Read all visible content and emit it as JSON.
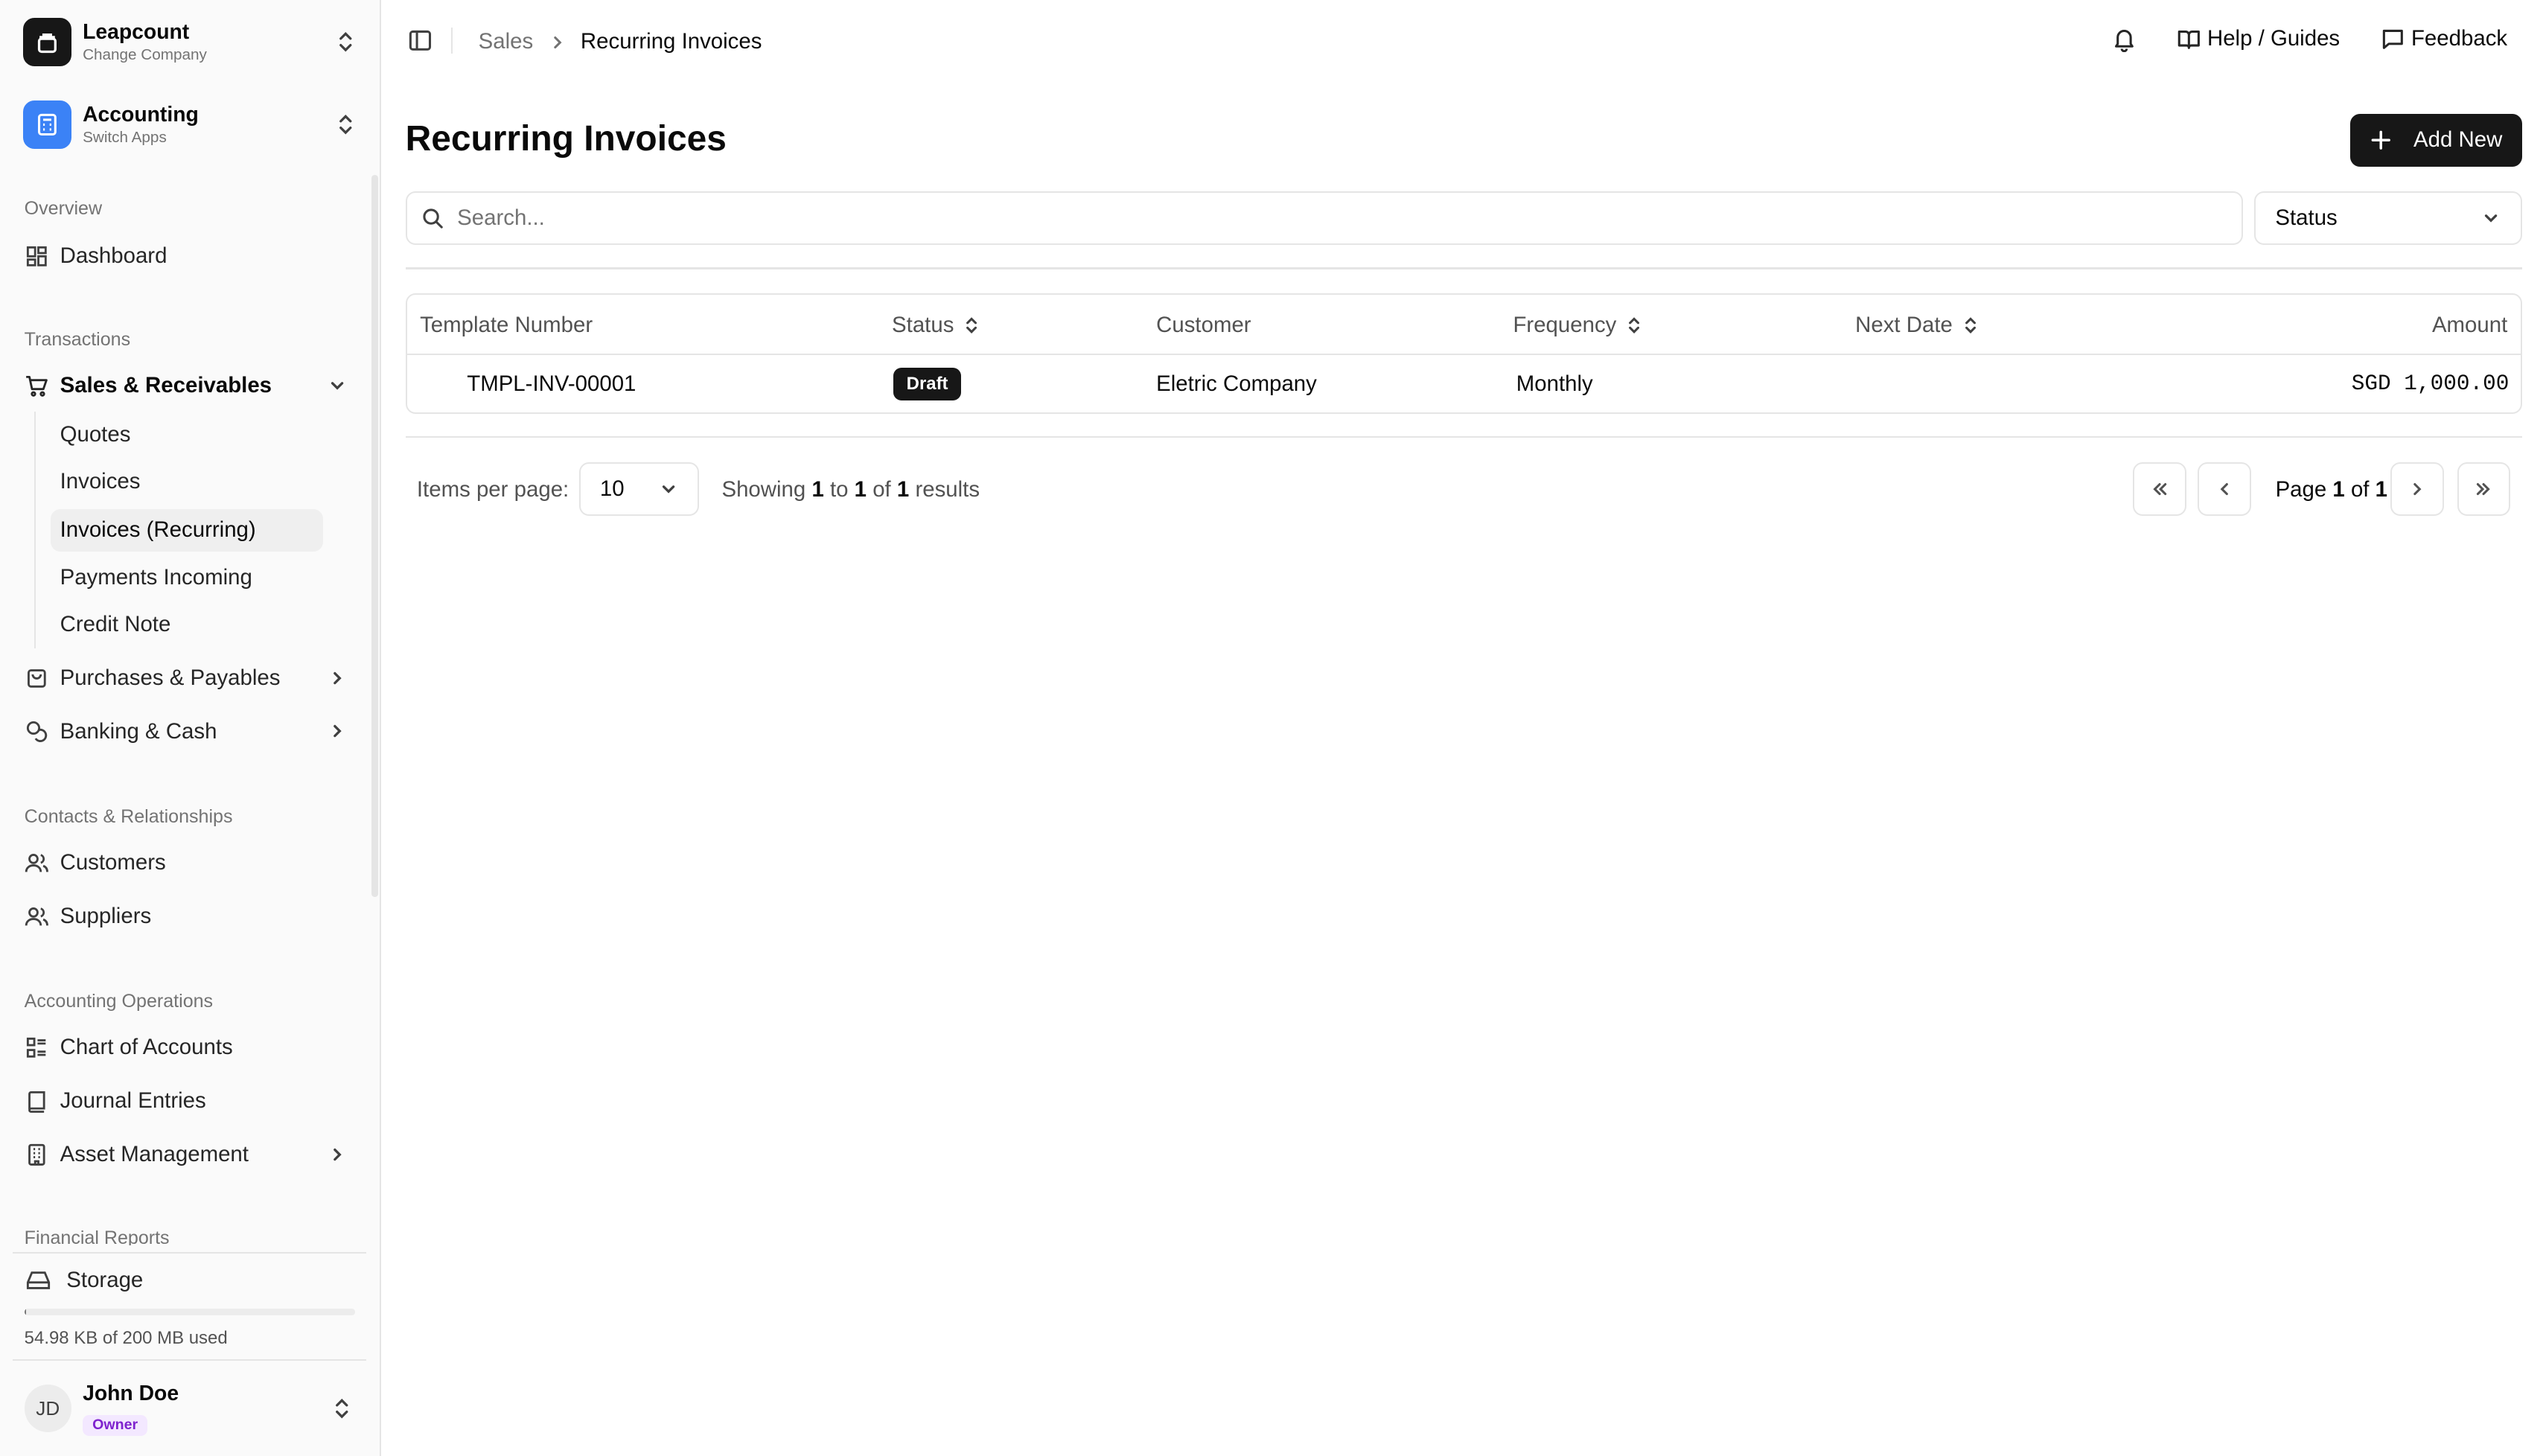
{
  "company": {
    "name": "Leapcount",
    "subtitle": "Change Company"
  },
  "app": {
    "name": "Accounting",
    "subtitle": "Switch Apps"
  },
  "sidebar": {
    "overview_label": "Overview",
    "dashboard": "Dashboard",
    "transactions_label": "Transactions",
    "sales": "Sales & Receivables",
    "sales_sub": [
      "Quotes",
      "Invoices",
      "Invoices (Recurring)",
      "Payments Incoming",
      "Credit Note"
    ],
    "purchases": "Purchases & Payables",
    "banking": "Banking & Cash",
    "contacts_label": "Contacts & Relationships",
    "customers": "Customers",
    "suppliers": "Suppliers",
    "accounting_ops_label": "Accounting Operations",
    "chart_of_accounts": "Chart of Accounts",
    "journal_entries": "Journal Entries",
    "asset_management": "Asset Management",
    "financial_reports_label": "Financial Reports"
  },
  "storage": {
    "label": "Storage",
    "usage_text": "54.98 KB of 200 MB used",
    "used_fraction": 0.0003
  },
  "user": {
    "name": "John Doe",
    "initials": "JD",
    "role": "Owner"
  },
  "breadcrumb": {
    "parent": "Sales",
    "current": "Recurring Invoices"
  },
  "topbar": {
    "help": "Help / Guides",
    "feedback": "Feedback"
  },
  "page": {
    "title": "Recurring Invoices",
    "add_label": "Add New"
  },
  "filters": {
    "search_placeholder": "Search...",
    "status_label": "Status"
  },
  "table": {
    "headers": {
      "template": "Template Number",
      "status": "Status",
      "customer": "Customer",
      "frequency": "Frequency",
      "next_date": "Next Date",
      "amount": "Amount"
    },
    "rows": [
      {
        "template": "TMPL-INV-00001",
        "status": "Draft",
        "customer": "Eletric Company",
        "frequency": "Monthly",
        "next_date": "",
        "amount": "SGD 1,000.00"
      }
    ]
  },
  "pagination": {
    "items_per_page_label": "Items per page:",
    "items_per_page": "10",
    "showing_prefix": "Showing",
    "from": "1",
    "to_word": "to",
    "to": "1",
    "of_word": "of",
    "total": "1",
    "results_word": "results",
    "page_word": "Page",
    "current_page": "1",
    "page_of_word": "of",
    "total_pages": "1"
  }
}
